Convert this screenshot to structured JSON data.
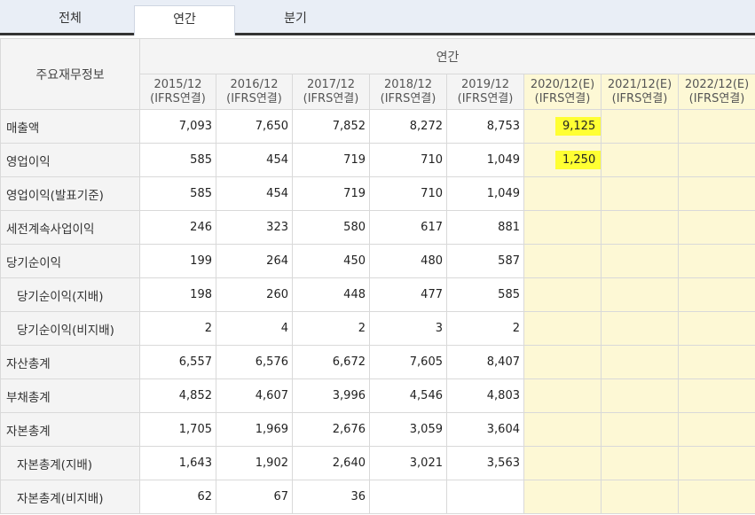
{
  "tabs": [
    {
      "label": "전체"
    },
    {
      "label": "연간"
    },
    {
      "label": "분기"
    }
  ],
  "header": {
    "title_col": "주요재무정보",
    "group": "연간",
    "periods": [
      {
        "year": "2015/12",
        "basis": "(IFRS연결)"
      },
      {
        "year": "2016/12",
        "basis": "(IFRS연결)"
      },
      {
        "year": "2017/12",
        "basis": "(IFRS연결)"
      },
      {
        "year": "2018/12",
        "basis": "(IFRS연결)"
      },
      {
        "year": "2019/12",
        "basis": "(IFRS연결)"
      },
      {
        "year": "2020/12(E)",
        "basis": "(IFRS연결)"
      },
      {
        "year": "2021/12(E)",
        "basis": "(IFRS연결)"
      },
      {
        "year": "2022/12(E)",
        "basis": "(IFRS연결)"
      }
    ]
  },
  "rows": [
    {
      "label": "매출액",
      "values": [
        "7,093",
        "7,650",
        "7,852",
        "8,272",
        "8,753",
        "9,125",
        "",
        ""
      ]
    },
    {
      "label": "영업이익",
      "values": [
        "585",
        "454",
        "719",
        "710",
        "1,049",
        "1,250",
        "",
        ""
      ]
    },
    {
      "label": "영업이익(발표기준)",
      "values": [
        "585",
        "454",
        "719",
        "710",
        "1,049",
        "",
        "",
        ""
      ]
    },
    {
      "label": "세전계속사업이익",
      "values": [
        "246",
        "323",
        "580",
        "617",
        "881",
        "",
        "",
        ""
      ]
    },
    {
      "label": "당기순이익",
      "values": [
        "199",
        "264",
        "450",
        "480",
        "587",
        "",
        "",
        ""
      ]
    },
    {
      "label": "당기순이익(지배)",
      "values": [
        "198",
        "260",
        "448",
        "477",
        "585",
        "",
        "",
        ""
      ]
    },
    {
      "label": "당기순이익(비지배)",
      "values": [
        "2",
        "4",
        "2",
        "3",
        "2",
        "",
        "",
        ""
      ]
    },
    {
      "label": "자산총계",
      "values": [
        "6,557",
        "6,576",
        "6,672",
        "7,605",
        "8,407",
        "",
        "",
        ""
      ]
    },
    {
      "label": "부채총계",
      "values": [
        "4,852",
        "4,607",
        "3,996",
        "4,546",
        "4,803",
        "",
        "",
        ""
      ]
    },
    {
      "label": "자본총계",
      "values": [
        "1,705",
        "1,969",
        "2,676",
        "3,059",
        "3,604",
        "",
        "",
        ""
      ]
    },
    {
      "label": "자본총계(지배)",
      "values": [
        "1,643",
        "1,902",
        "2,640",
        "3,021",
        "3,563",
        "",
        "",
        ""
      ]
    },
    {
      "label": "자본총계(비지배)",
      "values": [
        "62",
        "67",
        "36",
        "",
        "",
        "",
        "",
        ""
      ]
    }
  ],
  "colors": {
    "estimate_bg": "#fdf8d5",
    "highlight": "#ffff33"
  }
}
